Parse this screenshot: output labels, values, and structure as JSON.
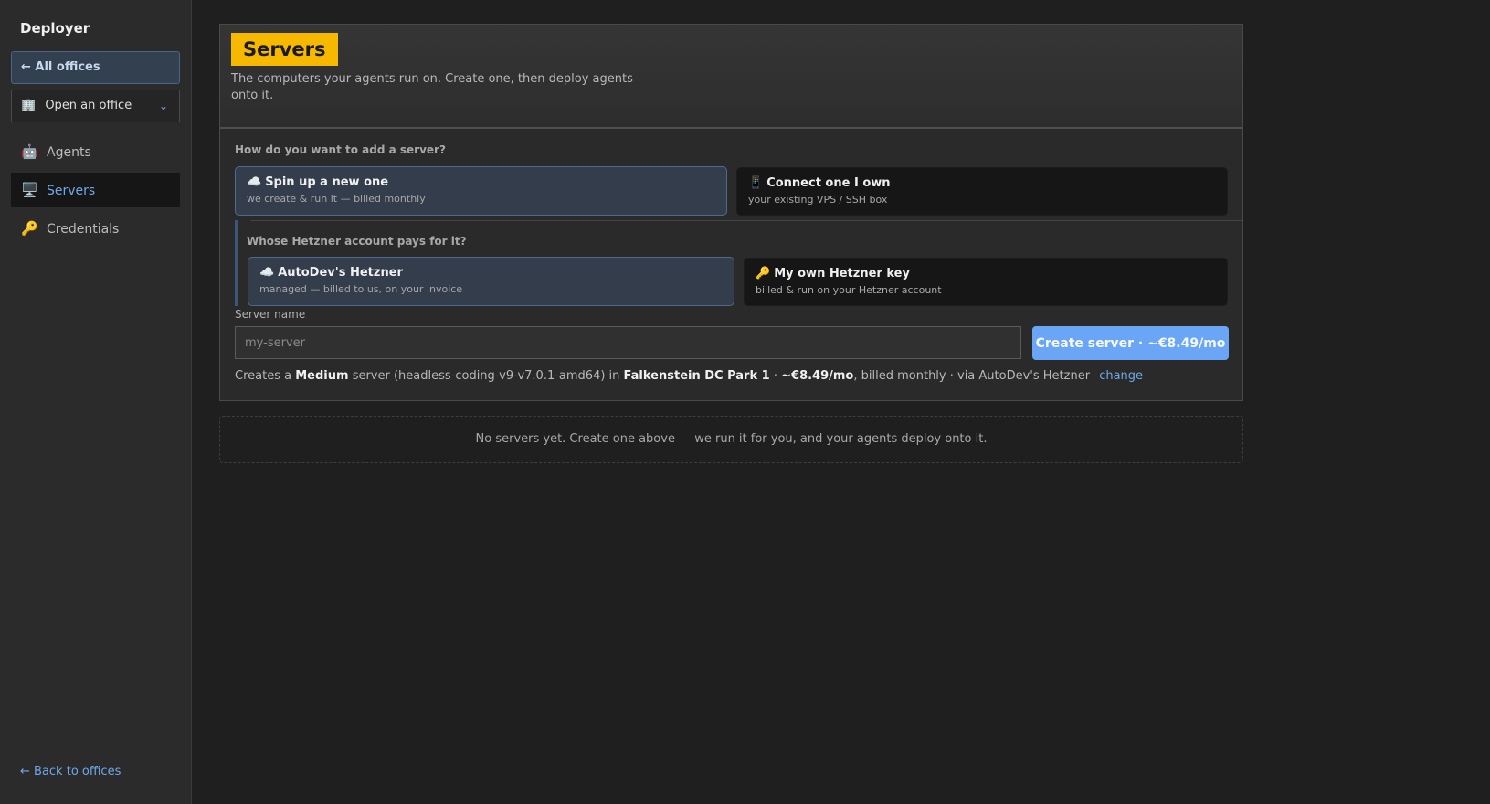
{
  "sidebar": {
    "brand": "Deployer",
    "all_offices": "← All offices",
    "office_select": {
      "icon": "🏢",
      "label": "Open an office"
    },
    "items": [
      {
        "icon": "🤖",
        "label": "Agents"
      },
      {
        "icon": "🖥️",
        "label": "Servers"
      },
      {
        "icon": "🔑",
        "label": "Credentials"
      }
    ],
    "back": "← Back to offices"
  },
  "header": {
    "title": "Servers",
    "subtitle": "The computers your agents run on. Create one, then deploy agents onto it."
  },
  "add_method": {
    "question": "How do you want to add a server?",
    "options": [
      {
        "icon": "☁️",
        "title": "Spin up a new one",
        "subtitle": "we create & run it — billed monthly",
        "selected": true
      },
      {
        "icon": "📱",
        "title": "Connect one I own",
        "subtitle": "your existing VPS / SSH box",
        "selected": false
      }
    ]
  },
  "account": {
    "question": "Whose Hetzner account pays for it?",
    "options": [
      {
        "icon": "☁️",
        "title": "AutoDev's Hetzner",
        "subtitle": "managed — billed to us, on your invoice",
        "selected": true
      },
      {
        "icon": "🔑",
        "title": "My own Hetzner key",
        "subtitle": "billed & run on your Hetzner account",
        "selected": false
      }
    ]
  },
  "form": {
    "name_label": "Server name",
    "name_placeholder": "my-server",
    "create_button": "Create server · ~€8.49/mo"
  },
  "summary": {
    "prefix": "Creates a",
    "size": "Medium",
    "image_text": "server (headless-coding-v9-v7.0.1-amd64) in",
    "location": "Falkenstein DC Park 1",
    "sep": "·",
    "price": "~€8.49/mo",
    "suffix": ", billed monthly · via AutoDev's Hetzner",
    "change": "change"
  },
  "empty_state": "No servers yet. Create one above — we run it for you, and your agents deploy onto it.",
  "colors": {
    "accent": "#6aa6f5",
    "title_badge": "#f7b800",
    "selected_option": "#333d4b"
  }
}
